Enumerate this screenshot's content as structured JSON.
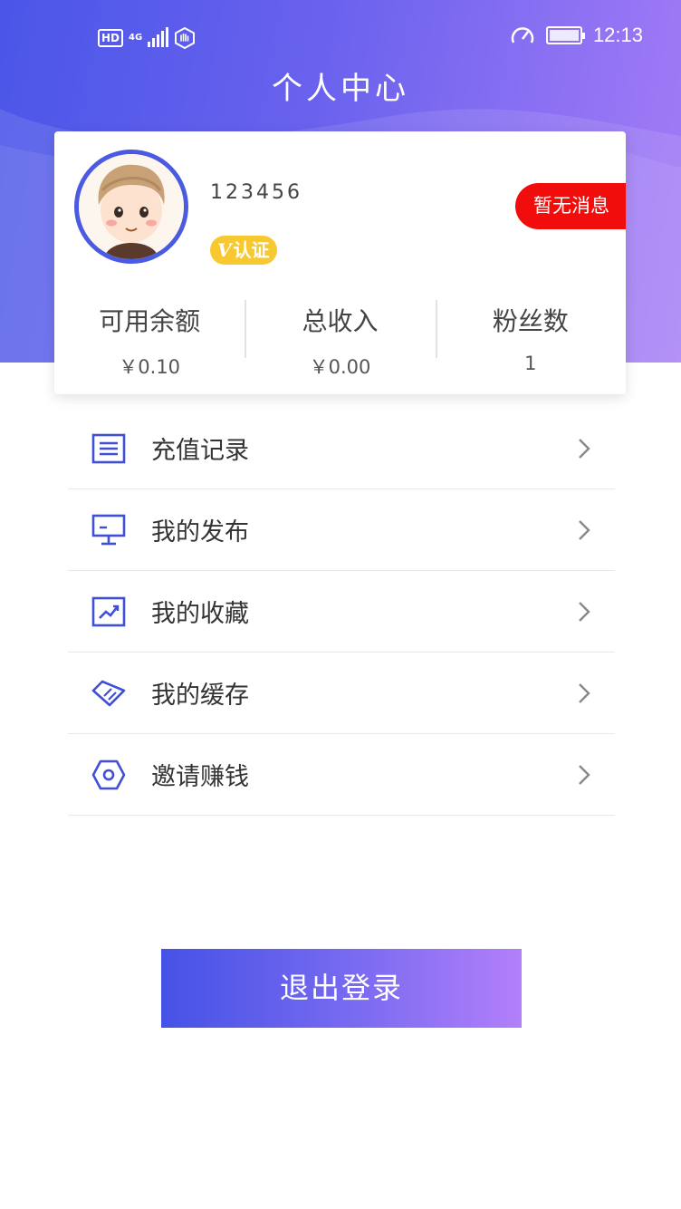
{
  "status_bar": {
    "hd": "HD",
    "network": "4G",
    "time": "12:13"
  },
  "header": {
    "title": "个人中心"
  },
  "profile": {
    "username": "123456",
    "verify_v": "V",
    "verify_label": "认证",
    "message_badge": "暂无消息",
    "stats": [
      {
        "label": "可用余额",
        "value": "￥0.10"
      },
      {
        "label": "总收入",
        "value": "￥0.00"
      },
      {
        "label": "粉丝数",
        "value": "1"
      }
    ]
  },
  "menu": {
    "items": [
      {
        "label": "充值记录",
        "icon": "list-icon"
      },
      {
        "label": "我的发布",
        "icon": "monitor-icon"
      },
      {
        "label": "我的收藏",
        "icon": "chart-icon"
      },
      {
        "label": "我的缓存",
        "icon": "tag-icon"
      },
      {
        "label": "邀请赚钱",
        "icon": "hexagon-icon"
      }
    ]
  },
  "logout": {
    "label": "退出登录"
  },
  "colors": {
    "accent": "#4a56e8",
    "accent_end": "#a57cf6",
    "badge_red": "#f20d0d",
    "verify_yellow": "#f7c830"
  }
}
